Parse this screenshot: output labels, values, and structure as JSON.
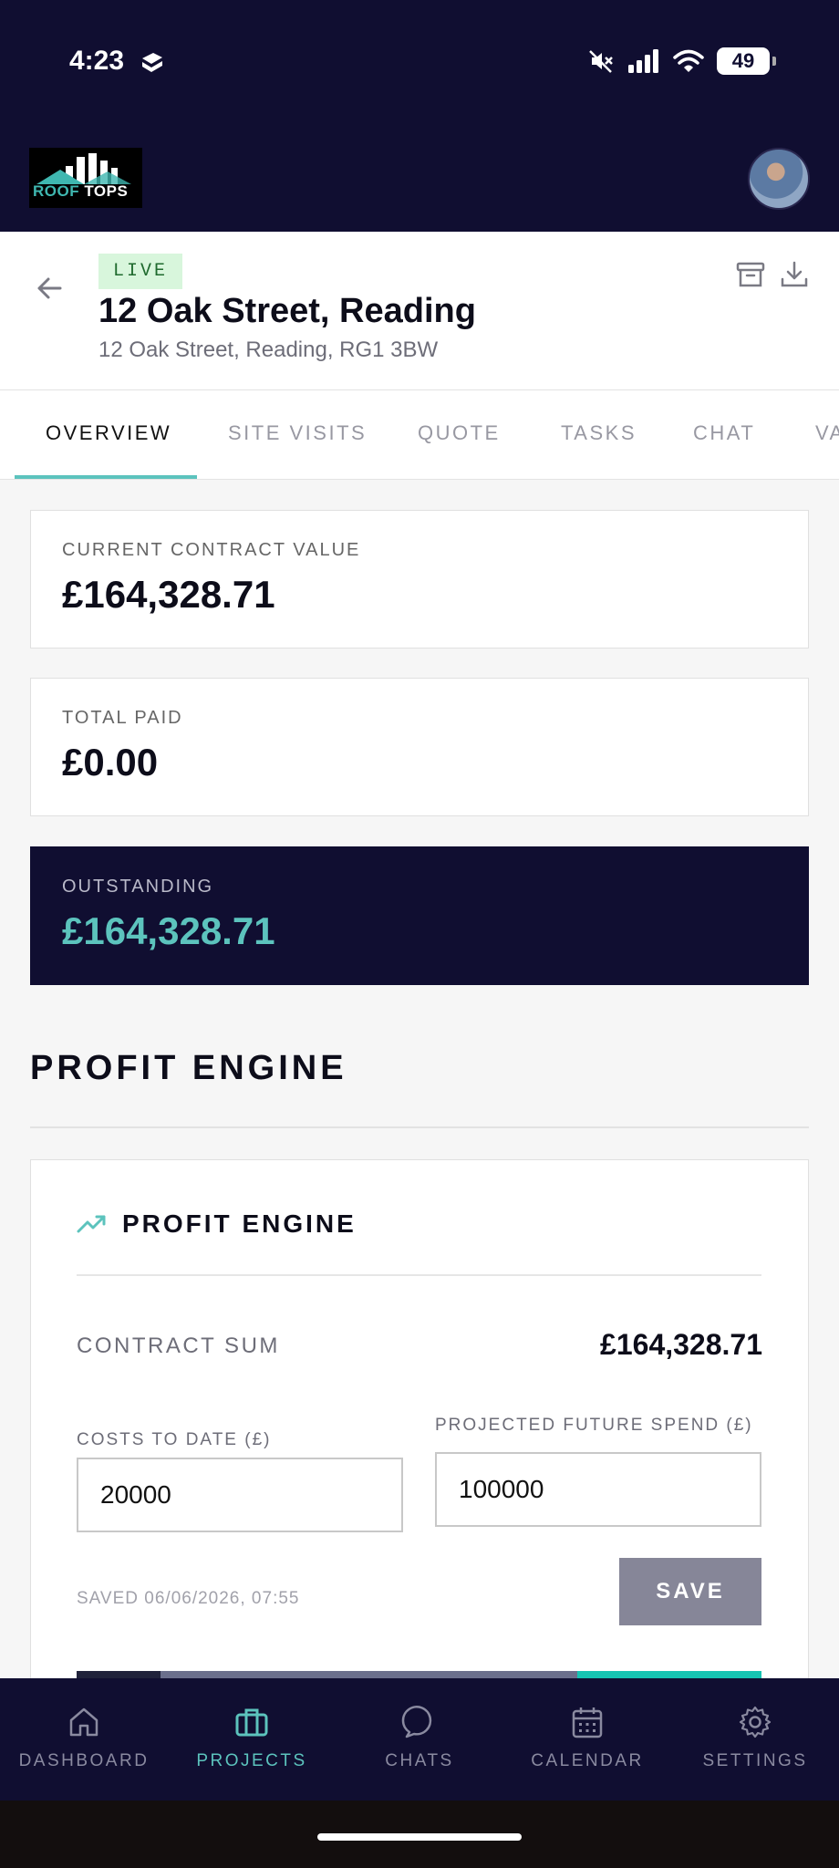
{
  "status_bar": {
    "time": "4:23",
    "battery": "49",
    "icons": [
      "app-notification-icon",
      "muted-icon",
      "signal-icon",
      "wifi-icon",
      "battery-icon"
    ]
  },
  "header": {
    "logo": {
      "word1": "ROOF",
      "word2": "TOPS"
    },
    "avatar": "avatar"
  },
  "project": {
    "status": "LIVE",
    "title": "12 Oak Street, Reading",
    "address": "12 Oak Street, Reading, RG1 3BW"
  },
  "tabs": [
    {
      "label": "OVERVIEW",
      "active": true
    },
    {
      "label": "SITE VISITS"
    },
    {
      "label": "QUOTE"
    },
    {
      "label": "TASKS"
    },
    {
      "label": "CHAT"
    },
    {
      "label": "VA"
    }
  ],
  "summary": {
    "contract": {
      "label": "CURRENT CONTRACT VALUE",
      "value": "£164,328.71"
    },
    "paid": {
      "label": "TOTAL PAID",
      "value": "£0.00"
    },
    "outstanding": {
      "label": "OUTSTANDING",
      "value": "£164,328.71"
    }
  },
  "profit_engine": {
    "section_title": "PROFIT ENGINE",
    "card_title": "PROFIT ENGINE",
    "contract_sum_label": "CONTRACT SUM",
    "contract_sum_value": "£164,328.71",
    "costs_label": "COSTS TO DATE (£)",
    "costs_value": "20000",
    "future_label": "PROJECTED FUTURE SPEND (£)",
    "future_value": "100000",
    "saved_text": "SAVED 06/06/2026, 07:55",
    "save_label": "SAVE",
    "breakdown": {
      "costs_fraction": 0.122,
      "future_fraction": 0.609,
      "profit_fraction": 0.269
    },
    "colors": {
      "costs": "#20223b",
      "future": "#6b6f8c",
      "profit": "#17c3b2"
    }
  },
  "bottom_nav": [
    {
      "label": "DASHBOARD",
      "icon": "home-icon"
    },
    {
      "label": "PROJECTS",
      "icon": "briefcase-icon",
      "active": true
    },
    {
      "label": "CHATS",
      "icon": "chat-bubble-icon"
    },
    {
      "label": "CALENDAR",
      "icon": "calendar-icon"
    },
    {
      "label": "SETTINGS",
      "icon": "gear-icon"
    }
  ],
  "colors": {
    "navy": "#100e31",
    "teal": "#5cc3bd",
    "live_badge_bg": "#d8f6dc"
  }
}
